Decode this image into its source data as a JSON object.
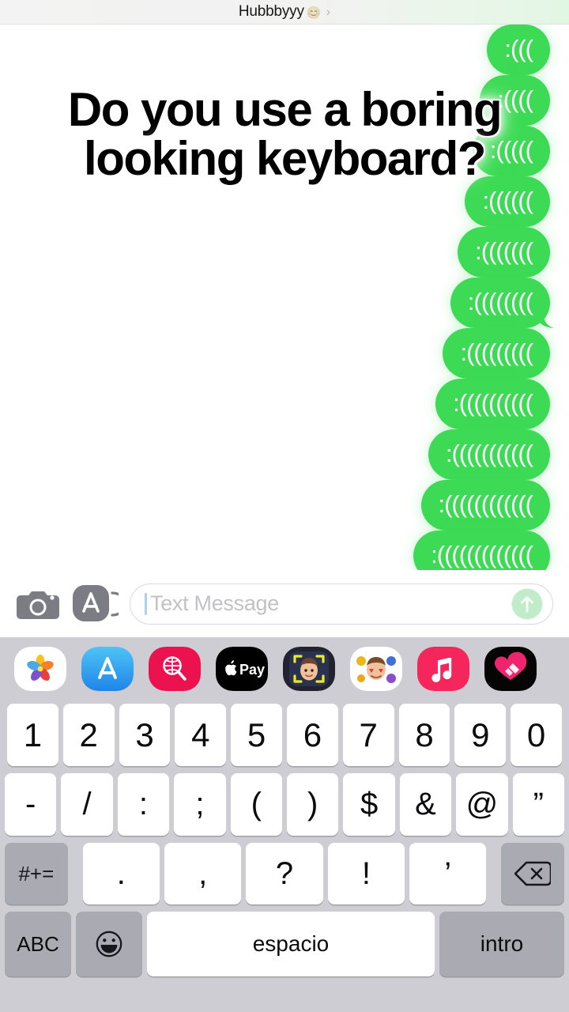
{
  "header": {
    "title": "Hubbbyyy",
    "emoji": "😊",
    "chevron": "›"
  },
  "overlay": {
    "line1": "Do you use a boring",
    "line2": "looking keyboard?"
  },
  "conversation": {
    "bubbles": [
      {
        "text": ":(((",
        "tail": false
      },
      {
        "text": ":((((",
        "tail": false
      },
      {
        "text": ":(((((",
        "tail": false
      },
      {
        "text": ":((((((",
        "tail": false
      },
      {
        "text": ":(((((((",
        "tail": false
      },
      {
        "text": ":((((((((",
        "tail": true
      },
      {
        "text": ":(((((((((",
        "tail": false
      },
      {
        "text": ":((((((((((",
        "tail": false
      },
      {
        "text": ":(((((((((((",
        "tail": false
      },
      {
        "text": ":((((((((((((",
        "tail": false
      },
      {
        "text": ":(((((((((((((",
        "tail": true
      }
    ],
    "bubble_color": "#3ddb55",
    "text_color": "#ffffff"
  },
  "input_bar": {
    "camera_icon": "camera-icon",
    "apps_icon": "app-store-icon",
    "placeholder": "Text Message",
    "value": "",
    "send_icon": "send-arrow-up-icon"
  },
  "app_drawer": [
    {
      "name": "photos-app-icon",
      "label": "Photos",
      "color": "#ffffff"
    },
    {
      "name": "app-store-app-icon",
      "label": "App Store",
      "color": "#2fa3f7"
    },
    {
      "name": "images-app-icon",
      "label": "#images",
      "color": "#ec1250"
    },
    {
      "name": "apple-pay-app-icon",
      "label": "Apple Pay",
      "color": "#000000"
    },
    {
      "name": "memoji-app-icon",
      "label": "Memoji",
      "color": "#1b1b26"
    },
    {
      "name": "stickers-app-icon",
      "label": "Memoji Stickers",
      "color": "#ffffff"
    },
    {
      "name": "music-app-icon",
      "label": "Music",
      "color": "#f5265c"
    },
    {
      "name": "fitness-app-icon",
      "label": "Fitness",
      "color": "#000000"
    }
  ],
  "keyboard": {
    "language": "espanol",
    "row1": [
      "1",
      "2",
      "3",
      "4",
      "5",
      "6",
      "7",
      "8",
      "9",
      "0"
    ],
    "row2": [
      "-",
      "/",
      ":",
      ";",
      "(",
      ")",
      "$",
      "&",
      "@",
      "”"
    ],
    "row3": {
      "shift_label": "#+=",
      "keys": [
        ".",
        ",",
        "?",
        "!",
        "’"
      ],
      "backspace_icon": "backspace-icon"
    },
    "row4": {
      "abc_label": "ABC",
      "emoji_icon": "emoji-smiley-icon",
      "space_label": "espacio",
      "return_label": "intro"
    },
    "key_bg": "#ffffff",
    "mod_key_bg": "#aaaab2",
    "keyboard_bg": "#cdcdd3"
  }
}
